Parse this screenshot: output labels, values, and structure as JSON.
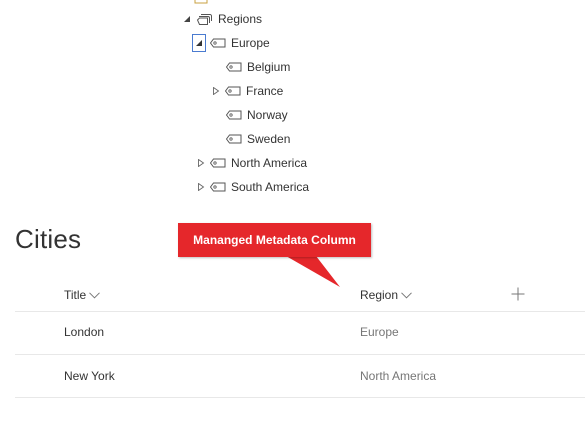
{
  "tree": {
    "root_label": "Regions",
    "europe_label": "Europe",
    "belgium_label": "Belgium",
    "france_label": "France",
    "norway_label": "Norway",
    "sweden_label": "Sweden",
    "north_america_label": "North America",
    "south_america_label": "South America"
  },
  "list": {
    "title": "Cities",
    "columns": {
      "title": "Title",
      "region": "Region"
    },
    "add_column_glyph": "+",
    "rows": [
      {
        "title": "London",
        "region": "Europe"
      },
      {
        "title": "New York",
        "region": "North America"
      }
    ]
  },
  "callout": {
    "text": "Mananged Metadata Column",
    "color": "#e5272b"
  }
}
